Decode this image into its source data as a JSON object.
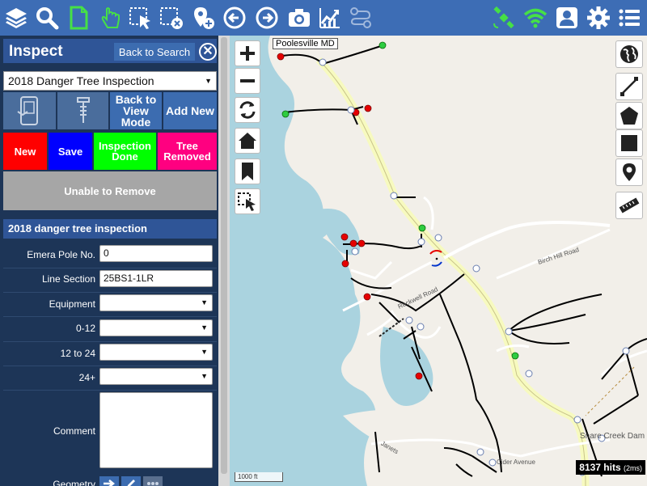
{
  "toolbar": {
    "left_icons": [
      "layers-icon",
      "search-icon",
      "document-icon",
      "hand-pointer-icon",
      "select-cursor-icon",
      "select-clear-icon",
      "location-add-icon",
      "back-arrow-icon",
      "forward-arrow-icon",
      "camera-icon",
      "chart-trend-icon",
      "route-icon"
    ],
    "right_icons": [
      "satellite-icon",
      "wifi-icon",
      "user-profile-icon",
      "gear-icon",
      "list-menu-icon"
    ]
  },
  "sidebar": {
    "title": "Inspect",
    "back_label": "Back to Search",
    "close_symbol": "✕",
    "inspection_type": "2018 Danger Tree Inspection",
    "mode_buttons": {
      "view_mode": "Back to View Mode",
      "add_new": "Add New"
    },
    "actions": {
      "new": "New",
      "save": "Save",
      "inspection_done": "Inspection Done",
      "tree_removed": "Tree Removed",
      "unable_to_remove": "Unable to Remove"
    },
    "colors": {
      "new": "#ff0000",
      "save": "#0000ff",
      "inspection_done": "#00ff00",
      "tree_removed": "#ff0080",
      "unable_to_remove": "#a6a6a6"
    },
    "section_title": "2018 danger tree inspection",
    "fields": {
      "pole_label": "Emera Pole No.",
      "pole_value": "0",
      "line_label": "Line Section",
      "line_value": "25BS1-1LR",
      "equipment_label": "Equipment",
      "range1_label": "0-12",
      "range2_label": "12 to 24",
      "range3_label": "24+",
      "comment_label": "Comment",
      "geometry_label": "Geometry"
    }
  },
  "map": {
    "town_label": "Poolesville MD",
    "scale": "1000 ft",
    "hits": "8137 hits",
    "hits_time": "(2ms)",
    "road_labels": [
      "Rockwell Road",
      "Birch Hill Road",
      "Snare Creek Dam",
      "Janets",
      "Cider Avenue"
    ],
    "controls_left": [
      "zoom-in-icon",
      "zoom-out-icon",
      "refresh-icon",
      "home-icon",
      "bookmark-icon",
      "select-tool-icon"
    ],
    "controls_right": [
      "globe-icon",
      "draw-line-icon",
      "draw-polygon-icon",
      "draw-rectangle-icon",
      "place-marker-icon",
      "measure-ruler-icon"
    ]
  }
}
